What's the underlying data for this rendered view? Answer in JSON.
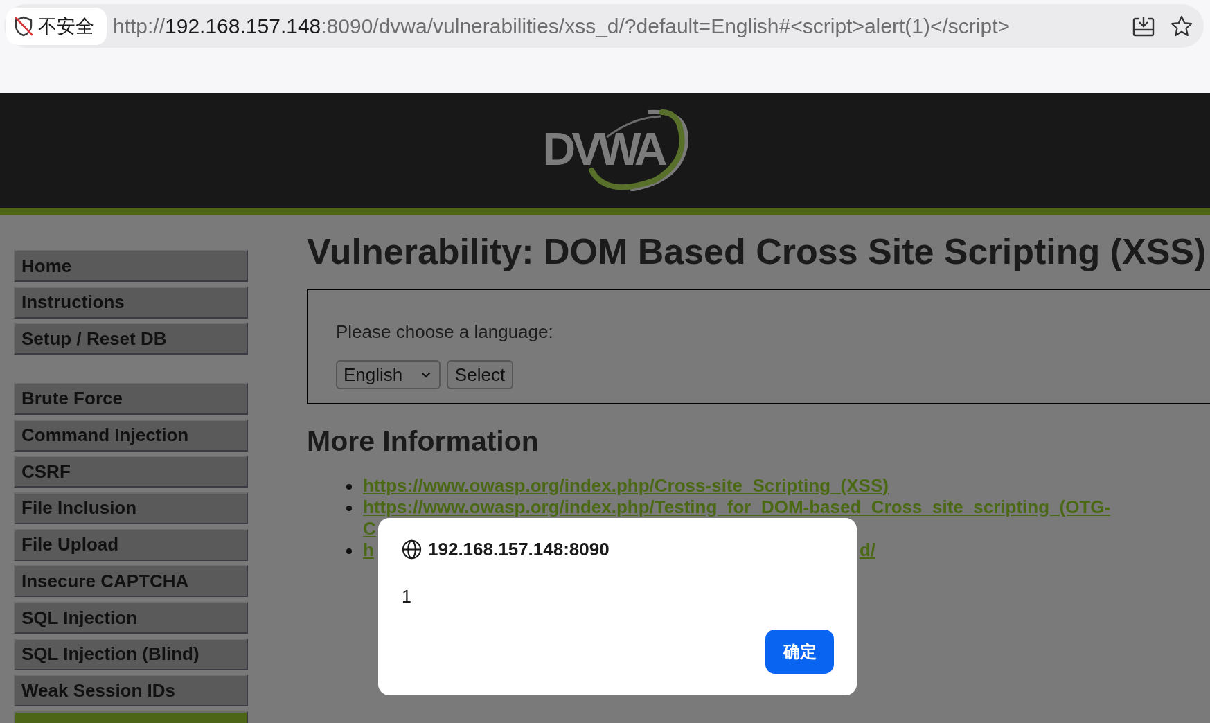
{
  "browser": {
    "security_label": "不安全",
    "url": {
      "scheme": "http://",
      "host": "192.168.157.148",
      "rest": ":8090/dvwa/vulnerabilities/xss_d/?default=English#<script>alert(1)</script>"
    }
  },
  "header": {
    "logo": "DVWA"
  },
  "sidebar": {
    "groups": [
      {
        "items": [
          {
            "label": "Home",
            "selected": false
          },
          {
            "label": "Instructions",
            "selected": false
          },
          {
            "label": "Setup / Reset DB",
            "selected": false
          }
        ]
      },
      {
        "items": [
          {
            "label": "Brute Force",
            "selected": false
          },
          {
            "label": "Command Injection",
            "selected": false
          },
          {
            "label": "CSRF",
            "selected": false
          },
          {
            "label": "File Inclusion",
            "selected": false
          },
          {
            "label": "File Upload",
            "selected": false
          },
          {
            "label": "Insecure CAPTCHA",
            "selected": false
          },
          {
            "label": "SQL Injection",
            "selected": false
          },
          {
            "label": "SQL Injection (Blind)",
            "selected": false
          },
          {
            "label": "Weak Session IDs",
            "selected": false
          },
          {
            "selected": true
          }
        ]
      }
    ]
  },
  "main": {
    "title": "Vulnerability: DOM Based Cross Site Scripting (XSS)",
    "form": {
      "prompt": "Please choose a language:",
      "language": "English",
      "submit": "Select"
    },
    "more_info": {
      "heading": "More Information",
      "links": [
        {
          "kind": "single",
          "parts": [
            "https://www.owasp.org/index.php/Cross-site_Scripting_(XSS)"
          ]
        },
        {
          "kind": "wrapped",
          "parts": [
            "https://www.owasp.org/index.php/Testing_for_DOM-based_Cross_site_scripting_(OTG-",
            "C"
          ]
        },
        {
          "kind": "split",
          "parts": [
            "h",
            "d/"
          ]
        }
      ]
    }
  },
  "dialog": {
    "origin": "192.168.157.148:8090",
    "message": "1",
    "ok": "确定"
  }
}
